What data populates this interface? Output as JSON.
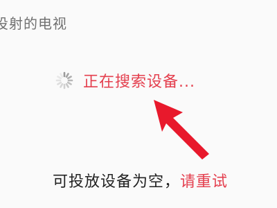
{
  "header": {
    "title": "投射的电视"
  },
  "status": {
    "searching_text": "正在搜索设备..."
  },
  "empty_state": {
    "message": "可投放设备为空",
    "separator": "，",
    "retry_label": "请重试"
  },
  "colors": {
    "accent": "#e43f4e",
    "arrow": "#e8192c",
    "text_dark": "#222222",
    "text_muted": "#707070"
  },
  "icons": {
    "spinner": "loading-spinner-icon",
    "arrow": "pointer-arrow-icon"
  }
}
